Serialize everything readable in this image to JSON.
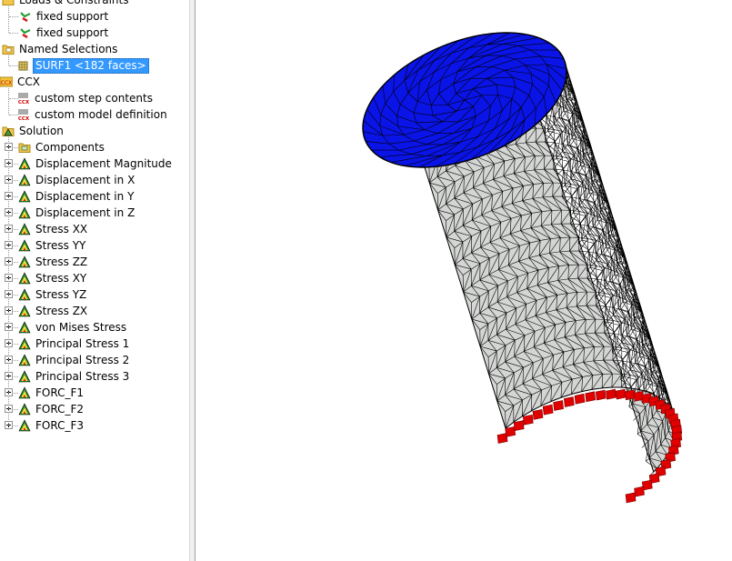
{
  "tree": {
    "loads_group": {
      "label": "Loads & Constraints"
    },
    "loads_children": [
      {
        "label": "fixed support"
      },
      {
        "label": "fixed support"
      }
    ],
    "named_selections": {
      "label": "Named Selections"
    },
    "named_children": [
      {
        "label": "SURF1 <182 faces>",
        "selected": true
      }
    ],
    "ccx_group": {
      "label": "CCX",
      "icon_text": "CCX"
    },
    "ccx_children": [
      {
        "label": "custom step contents"
      },
      {
        "label": "custom model definition"
      }
    ],
    "solution_group": {
      "label": "Solution"
    },
    "solution_children": [
      {
        "label": "Components",
        "icon": "folder-icon"
      },
      {
        "label": "Displacement Magnitude",
        "icon": "result-icon"
      },
      {
        "label": "Displacement in X",
        "icon": "result-icon"
      },
      {
        "label": "Displacement in Y",
        "icon": "result-icon"
      },
      {
        "label": "Displacement in Z",
        "icon": "result-icon"
      },
      {
        "label": "Stress XX",
        "icon": "result-icon"
      },
      {
        "label": "Stress YY",
        "icon": "result-icon"
      },
      {
        "label": "Stress ZZ",
        "icon": "result-icon"
      },
      {
        "label": "Stress XY",
        "icon": "result-icon"
      },
      {
        "label": "Stress YZ",
        "icon": "result-icon"
      },
      {
        "label": "Stress ZX",
        "icon": "result-icon"
      },
      {
        "label": "von Mises Stress",
        "icon": "result-icon"
      },
      {
        "label": "Principal Stress 1",
        "icon": "result-icon"
      },
      {
        "label": "Principal Stress 2",
        "icon": "result-icon"
      },
      {
        "label": "Principal Stress 3",
        "icon": "result-icon"
      },
      {
        "label": "FORC_F1",
        "icon": "result-icon"
      },
      {
        "label": "FORC_F2",
        "icon": "result-icon"
      },
      {
        "label": "FORC_F3",
        "icon": "result-icon"
      }
    ]
  },
  "colors": {
    "selection": "#3399ff",
    "top_face": "#0a14e6",
    "mesh_body": "#d4d6d4",
    "constraint_markers": "#e10000"
  }
}
